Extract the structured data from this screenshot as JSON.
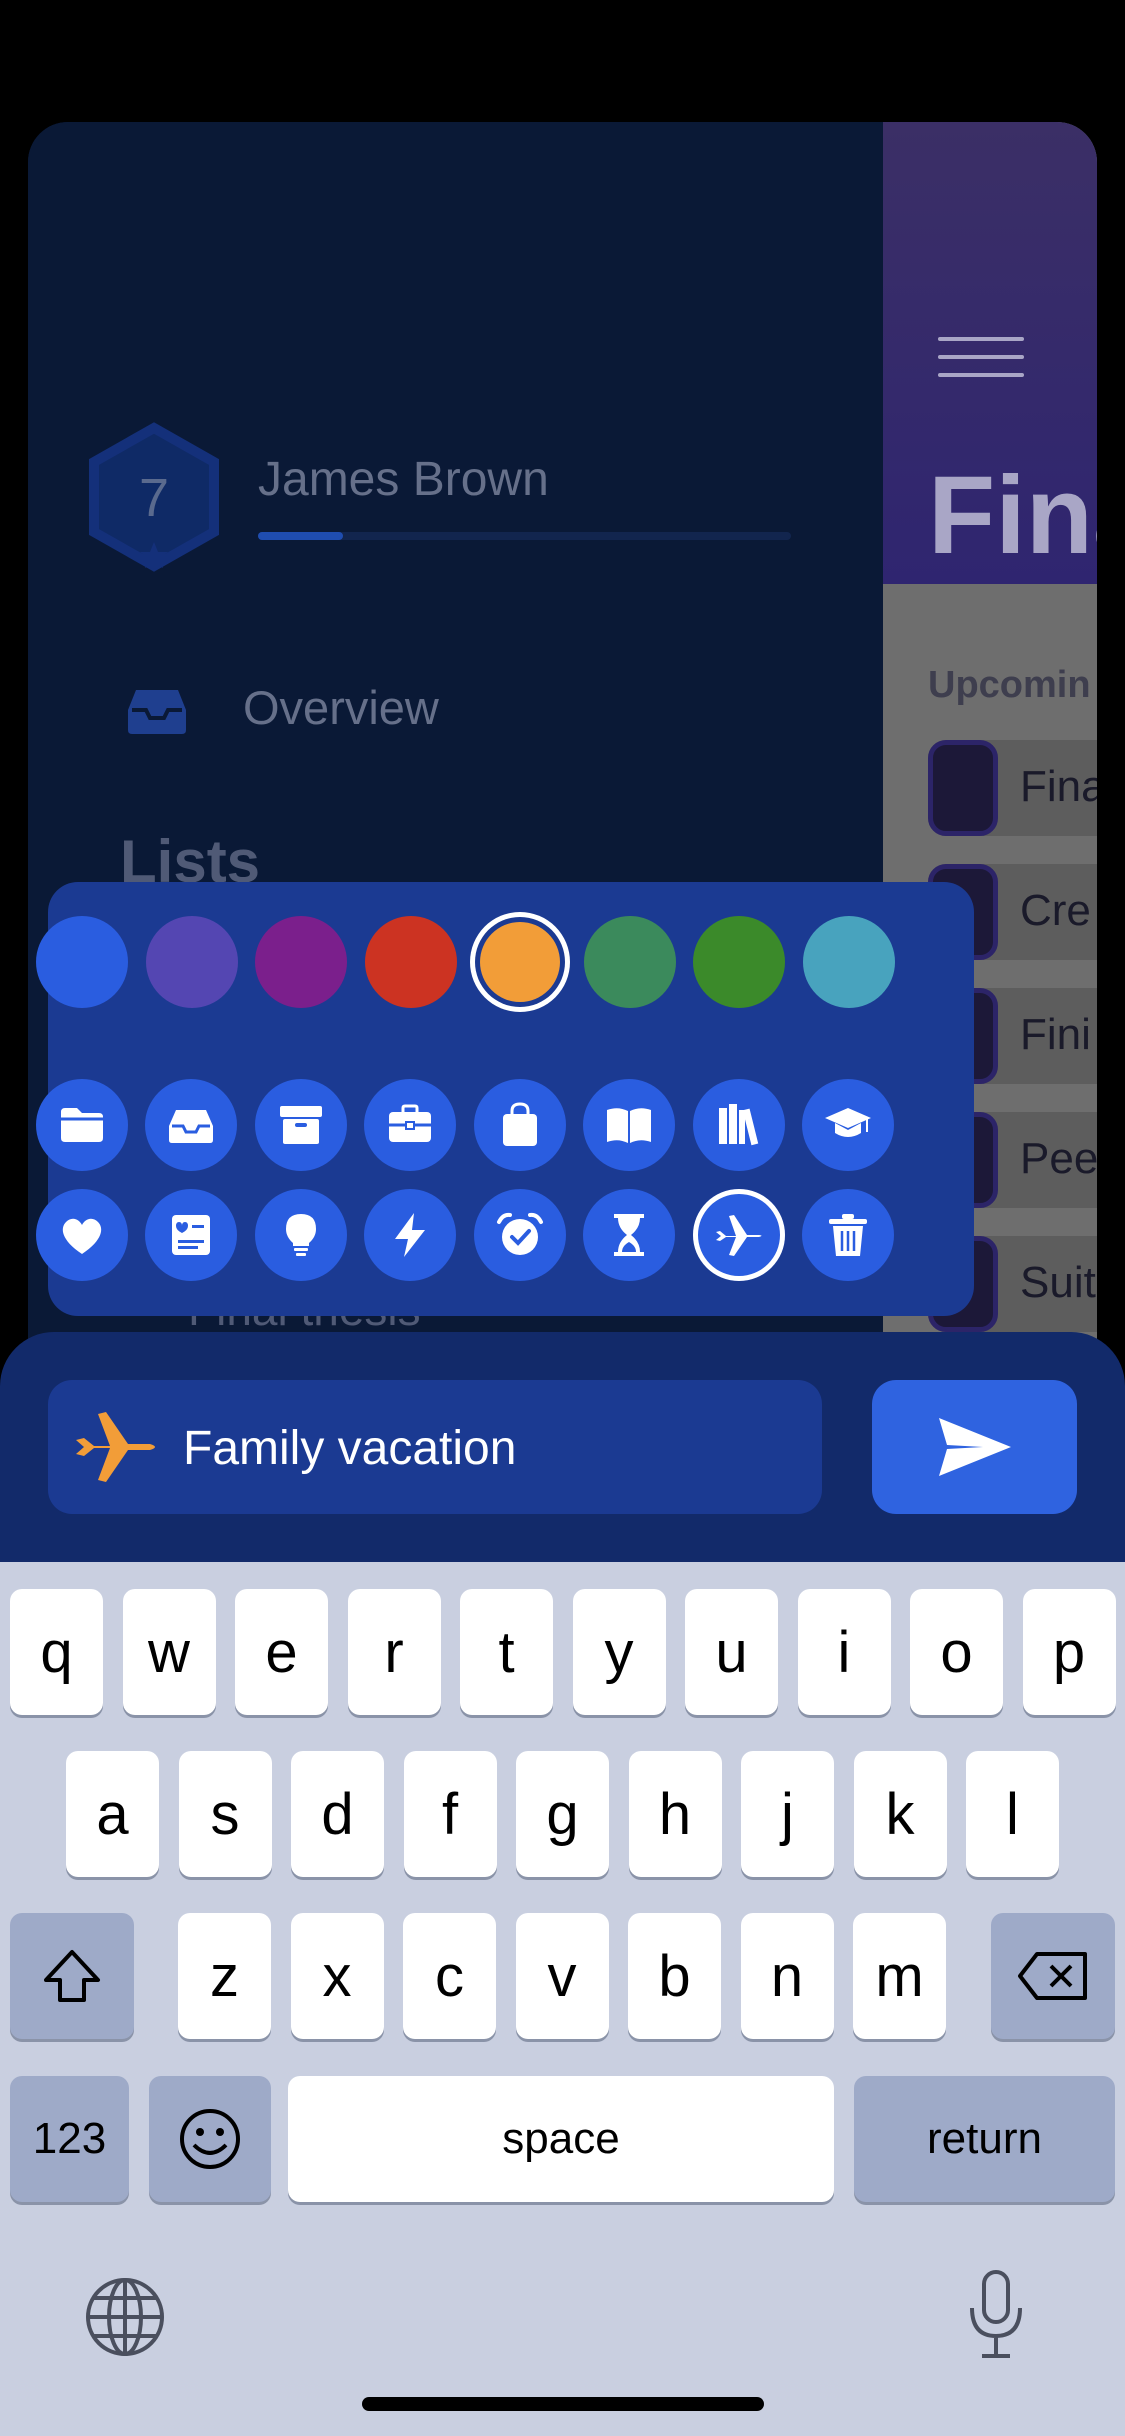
{
  "sidebar": {
    "level": "7",
    "user_name": "James Brown",
    "level_progress": 0.16,
    "overview_label": "Overview",
    "lists_heading": "Lists",
    "hidden_item_label": "Final thesis"
  },
  "main": {
    "title": "Fina",
    "upcoming_label": "Upcomin",
    "items": [
      {
        "label": "Fina"
      },
      {
        "label": "Cre"
      },
      {
        "label": "Fini"
      },
      {
        "label": "Pee"
      },
      {
        "label": "Suit"
      }
    ]
  },
  "picker": {
    "colors": [
      {
        "name": "blue",
        "hex": "#2a5de0"
      },
      {
        "name": "indigo",
        "hex": "#5446b2"
      },
      {
        "name": "purple",
        "hex": "#7b1f8c"
      },
      {
        "name": "red",
        "hex": "#cc3322"
      },
      {
        "name": "orange",
        "hex": "#f29d38",
        "selected": true
      },
      {
        "name": "teal-green",
        "hex": "#3b8a5c"
      },
      {
        "name": "green",
        "hex": "#3b8a2a"
      },
      {
        "name": "cyan",
        "hex": "#48a3be"
      }
    ],
    "icons": [
      "folder-icon",
      "inbox-tray-icon",
      "archive-box-icon",
      "briefcase-icon",
      "shopping-bag-icon",
      "open-book-icon",
      "books-icon",
      "graduation-cap-icon",
      "heart-icon",
      "id-card-icon",
      "lightbulb-icon",
      "lightning-bolt-icon",
      "alarm-clock-icon",
      "hourglass-icon",
      "airplane-icon",
      "trash-icon"
    ],
    "selected_icon": "airplane-icon"
  },
  "input": {
    "value": "Family vacation",
    "icon": "airplane-icon",
    "icon_color": "#f29d38"
  },
  "keyboard": {
    "row1": [
      "q",
      "w",
      "e",
      "r",
      "t",
      "y",
      "u",
      "i",
      "o",
      "p"
    ],
    "row2": [
      "a",
      "s",
      "d",
      "f",
      "g",
      "h",
      "j",
      "k",
      "l"
    ],
    "row3": [
      "z",
      "x",
      "c",
      "v",
      "b",
      "n",
      "m"
    ],
    "numbers_label": "123",
    "space_label": "space",
    "return_label": "return"
  }
}
